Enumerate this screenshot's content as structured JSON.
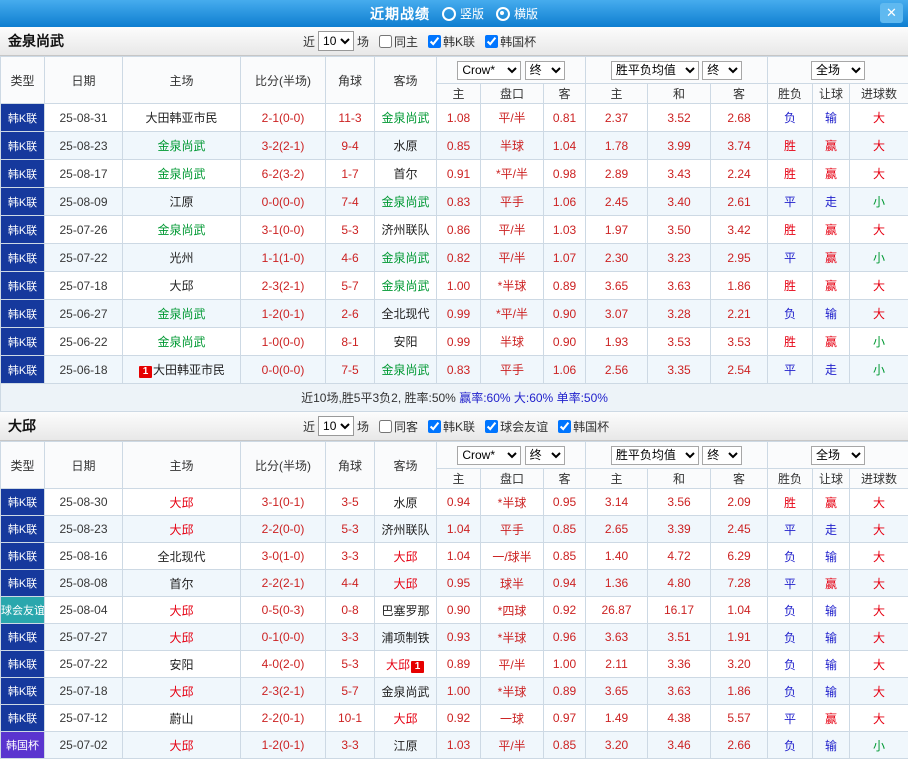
{
  "titlebar": {
    "title": "近期战绩",
    "radios": [
      {
        "label": "竖版",
        "selected": false
      },
      {
        "label": "横版",
        "selected": true
      }
    ],
    "close_label": "✕"
  },
  "table_header": {
    "type": "类型",
    "date": "日期",
    "home": "主场",
    "score": "比分(半场)",
    "corner": "角球",
    "away": "客场",
    "asian": {
      "company_select": "Crow*",
      "final_select": "终",
      "cols": [
        "主",
        "盘口",
        "客"
      ]
    },
    "europe": {
      "avg_select": "胜平负均值",
      "final_select": "终",
      "cols": [
        "主",
        "和",
        "客"
      ]
    },
    "full": {
      "scope_select": "全场",
      "cols": [
        "胜负",
        "让球",
        "进球数"
      ]
    }
  },
  "value_colors": {
    "red": "#e60012",
    "blue": "#2222cc",
    "green": "#009933"
  },
  "league_colors": {
    "韩K联": "#16399d",
    "球会友谊": "#2aa7ad",
    "韩国杯": "#5a35cf"
  },
  "sections": [
    {
      "team": "金泉尚武",
      "filter": {
        "near_label": "近",
        "count": "10",
        "games_label": "场",
        "checkboxes": [
          {
            "label": "同主",
            "checked": false
          },
          {
            "label": "韩K联",
            "checked": true
          },
          {
            "label": "韩国杯",
            "checked": true
          }
        ]
      },
      "rows": [
        {
          "lg": "韩K联",
          "d": "25-08-31",
          "h": "大田韩亚市民",
          "hc": "",
          "hb": "",
          "s": "2-1(0-0)",
          "cn": "11-3",
          "a": "金泉尚武",
          "ac": "green",
          "ab": "",
          "o1": "1.08",
          "pk": "平/半",
          "o2": "0.81",
          "e1": "2.37",
          "e2": "3.52",
          "e3": "2.68",
          "r1": "负",
          "r1c": "blue",
          "r2": "输",
          "r2c": "blue",
          "r3": "大",
          "r3c": "red"
        },
        {
          "lg": "韩K联",
          "d": "25-08-23",
          "h": "金泉尚武",
          "hc": "green",
          "hb": "",
          "s": "3-2(2-1)",
          "cn": "9-4",
          "a": "水原",
          "ac": "",
          "ab": "",
          "o1": "0.85",
          "pk": "半球",
          "o2": "1.04",
          "e1": "1.78",
          "e2": "3.99",
          "e3": "3.74",
          "r1": "胜",
          "r1c": "red",
          "r2": "赢",
          "r2c": "red",
          "r3": "大",
          "r3c": "red"
        },
        {
          "lg": "韩K联",
          "d": "25-08-17",
          "h": "金泉尚武",
          "hc": "green",
          "hb": "",
          "s": "6-2(3-2)",
          "cn": "1-7",
          "a": "首尔",
          "ac": "",
          "ab": "",
          "o1": "0.91",
          "pk": "*平/半",
          "o2": "0.98",
          "e1": "2.89",
          "e2": "3.43",
          "e3": "2.24",
          "r1": "胜",
          "r1c": "red",
          "r2": "赢",
          "r2c": "red",
          "r3": "大",
          "r3c": "red"
        },
        {
          "lg": "韩K联",
          "d": "25-08-09",
          "h": "江原",
          "hc": "",
          "hb": "",
          "s": "0-0(0-0)",
          "cn": "7-4",
          "a": "金泉尚武",
          "ac": "green",
          "ab": "",
          "o1": "0.83",
          "pk": "平手",
          "o2": "1.06",
          "e1": "2.45",
          "e2": "3.40",
          "e3": "2.61",
          "r1": "平",
          "r1c": "blue",
          "r2": "走",
          "r2c": "blue",
          "r3": "小",
          "r3c": "green"
        },
        {
          "lg": "韩K联",
          "d": "25-07-26",
          "h": "金泉尚武",
          "hc": "green",
          "hb": "",
          "s": "3-1(0-0)",
          "cn": "5-3",
          "a": "济州联队",
          "ac": "",
          "ab": "",
          "o1": "0.86",
          "pk": "平/半",
          "o2": "1.03",
          "e1": "1.97",
          "e2": "3.50",
          "e3": "3.42",
          "r1": "胜",
          "r1c": "red",
          "r2": "赢",
          "r2c": "red",
          "r3": "大",
          "r3c": "red"
        },
        {
          "lg": "韩K联",
          "d": "25-07-22",
          "h": "光州",
          "hc": "",
          "hb": "",
          "s": "1-1(1-0)",
          "cn": "4-6",
          "a": "金泉尚武",
          "ac": "green",
          "ab": "",
          "o1": "0.82",
          "pk": "平/半",
          "o2": "1.07",
          "e1": "2.30",
          "e2": "3.23",
          "e3": "2.95",
          "r1": "平",
          "r1c": "blue",
          "r2": "赢",
          "r2c": "red",
          "r3": "小",
          "r3c": "green"
        },
        {
          "lg": "韩K联",
          "d": "25-07-18",
          "h": "大邱",
          "hc": "",
          "hb": "",
          "s": "2-3(2-1)",
          "cn": "5-7",
          "a": "金泉尚武",
          "ac": "green",
          "ab": "",
          "o1": "1.00",
          "pk": "*半球",
          "o2": "0.89",
          "e1": "3.65",
          "e2": "3.63",
          "e3": "1.86",
          "r1": "胜",
          "r1c": "red",
          "r2": "赢",
          "r2c": "red",
          "r3": "大",
          "r3c": "red"
        },
        {
          "lg": "韩K联",
          "d": "25-06-27",
          "h": "金泉尚武",
          "hc": "green",
          "hb": "",
          "s": "1-2(0-1)",
          "cn": "2-6",
          "a": "全北现代",
          "ac": "",
          "ab": "",
          "o1": "0.99",
          "pk": "*平/半",
          "o2": "0.90",
          "e1": "3.07",
          "e2": "3.28",
          "e3": "2.21",
          "r1": "负",
          "r1c": "blue",
          "r2": "输",
          "r2c": "blue",
          "r3": "大",
          "r3c": "red"
        },
        {
          "lg": "韩K联",
          "d": "25-06-22",
          "h": "金泉尚武",
          "hc": "green",
          "hb": "",
          "s": "1-0(0-0)",
          "cn": "8-1",
          "a": "安阳",
          "ac": "",
          "ab": "",
          "o1": "0.99",
          "pk": "半球",
          "o2": "0.90",
          "e1": "1.93",
          "e2": "3.53",
          "e3": "3.53",
          "r1": "胜",
          "r1c": "red",
          "r2": "赢",
          "r2c": "red",
          "r3": "小",
          "r3c": "green"
        },
        {
          "lg": "韩K联",
          "d": "25-06-18",
          "h": "大田韩亚市民",
          "hc": "",
          "hb": "1",
          "s": "0-0(0-0)",
          "cn": "7-5",
          "a": "金泉尚武",
          "ac": "green",
          "ab": "",
          "o1": "0.83",
          "pk": "平手",
          "o2": "1.06",
          "e1": "2.56",
          "e2": "3.35",
          "e3": "2.54",
          "r1": "平",
          "r1c": "blue",
          "r2": "走",
          "r2c": "blue",
          "r3": "小",
          "r3c": "green"
        }
      ],
      "summary": [
        {
          "text": "近10场,胜5平3负2, 胜率:50% ",
          "color": "#333333"
        },
        {
          "text": "赢率:60% ",
          "color": "#2222cc"
        },
        {
          "text": "大:60% ",
          "color": "#2222cc"
        },
        {
          "text": "单率:50%",
          "color": "#2222cc"
        }
      ]
    },
    {
      "team": "大邱",
      "filter": {
        "near_label": "近",
        "count": "10",
        "games_label": "场",
        "checkboxes": [
          {
            "label": "同客",
            "checked": false
          },
          {
            "label": "韩K联",
            "checked": true
          },
          {
            "label": "球会友谊",
            "checked": true
          },
          {
            "label": "韩国杯",
            "checked": true
          }
        ]
      },
      "rows": [
        {
          "lg": "韩K联",
          "d": "25-08-30",
          "h": "大邱",
          "hc": "red",
          "hb": "",
          "s": "3-1(0-1)",
          "cn": "3-5",
          "a": "水原",
          "ac": "",
          "ab": "",
          "o1": "0.94",
          "pk": "*半球",
          "o2": "0.95",
          "e1": "3.14",
          "e2": "3.56",
          "e3": "2.09",
          "r1": "胜",
          "r1c": "red",
          "r2": "赢",
          "r2c": "red",
          "r3": "大",
          "r3c": "red"
        },
        {
          "lg": "韩K联",
          "d": "25-08-23",
          "h": "大邱",
          "hc": "red",
          "hb": "",
          "s": "2-2(0-0)",
          "cn": "5-3",
          "a": "济州联队",
          "ac": "",
          "ab": "",
          "o1": "1.04",
          "pk": "平手",
          "o2": "0.85",
          "e1": "2.65",
          "e2": "3.39",
          "e3": "2.45",
          "r1": "平",
          "r1c": "blue",
          "r2": "走",
          "r2c": "blue",
          "r3": "大",
          "r3c": "red"
        },
        {
          "lg": "韩K联",
          "d": "25-08-16",
          "h": "全北现代",
          "hc": "",
          "hb": "",
          "s": "3-0(1-0)",
          "cn": "3-3",
          "a": "大邱",
          "ac": "red",
          "ab": "",
          "o1": "1.04",
          "pk": "一/球半",
          "o2": "0.85",
          "e1": "1.40",
          "e2": "4.72",
          "e3": "6.29",
          "r1": "负",
          "r1c": "blue",
          "r2": "输",
          "r2c": "blue",
          "r3": "大",
          "r3c": "red"
        },
        {
          "lg": "韩K联",
          "d": "25-08-08",
          "h": "首尔",
          "hc": "",
          "hb": "",
          "s": "2-2(2-1)",
          "cn": "4-4",
          "a": "大邱",
          "ac": "red",
          "ab": "",
          "o1": "0.95",
          "pk": "球半",
          "o2": "0.94",
          "e1": "1.36",
          "e2": "4.80",
          "e3": "7.28",
          "r1": "平",
          "r1c": "blue",
          "r2": "赢",
          "r2c": "red",
          "r3": "大",
          "r3c": "red"
        },
        {
          "lg": "球会友谊",
          "d": "25-08-04",
          "h": "大邱",
          "hc": "red",
          "hb": "",
          "s": "0-5(0-3)",
          "cn": "0-8",
          "a": "巴塞罗那",
          "ac": "",
          "ab": "",
          "o1": "0.90",
          "pk": "*四球",
          "o2": "0.92",
          "e1": "26.87",
          "e2": "16.17",
          "e3": "1.04",
          "r1": "负",
          "r1c": "blue",
          "r2": "输",
          "r2c": "blue",
          "r3": "大",
          "r3c": "red"
        },
        {
          "lg": "韩K联",
          "d": "25-07-27",
          "h": "大邱",
          "hc": "red",
          "hb": "",
          "s": "0-1(0-0)",
          "cn": "3-3",
          "a": "浦项制铁",
          "ac": "",
          "ab": "",
          "o1": "0.93",
          "pk": "*半球",
          "o2": "0.96",
          "e1": "3.63",
          "e2": "3.51",
          "e3": "1.91",
          "r1": "负",
          "r1c": "blue",
          "r2": "输",
          "r2c": "blue",
          "r3": "大",
          "r3c": "red"
        },
        {
          "lg": "韩K联",
          "d": "25-07-22",
          "h": "安阳",
          "hc": "",
          "hb": "",
          "s": "4-0(2-0)",
          "cn": "5-3",
          "a": "大邱",
          "ac": "red",
          "ab": "1",
          "o1": "0.89",
          "pk": "平/半",
          "o2": "1.00",
          "e1": "2.11",
          "e2": "3.36",
          "e3": "3.20",
          "r1": "负",
          "r1c": "blue",
          "r2": "输",
          "r2c": "blue",
          "r3": "大",
          "r3c": "red"
        },
        {
          "lg": "韩K联",
          "d": "25-07-18",
          "h": "大邱",
          "hc": "red",
          "hb": "",
          "s": "2-3(2-1)",
          "cn": "5-7",
          "a": "金泉尚武",
          "ac": "",
          "ab": "",
          "o1": "1.00",
          "pk": "*半球",
          "o2": "0.89",
          "e1": "3.65",
          "e2": "3.63",
          "e3": "1.86",
          "r1": "负",
          "r1c": "blue",
          "r2": "输",
          "r2c": "blue",
          "r3": "大",
          "r3c": "red"
        },
        {
          "lg": "韩K联",
          "d": "25-07-12",
          "h": "蔚山",
          "hc": "",
          "hb": "",
          "s": "2-2(0-1)",
          "cn": "10-1",
          "a": "大邱",
          "ac": "red",
          "ab": "",
          "o1": "0.92",
          "pk": "一球",
          "o2": "0.97",
          "e1": "1.49",
          "e2": "4.38",
          "e3": "5.57",
          "r1": "平",
          "r1c": "blue",
          "r2": "赢",
          "r2c": "red",
          "r3": "大",
          "r3c": "red"
        },
        {
          "lg": "韩国杯",
          "d": "25-07-02",
          "h": "大邱",
          "hc": "red",
          "hb": "",
          "s": "1-2(0-1)",
          "cn": "3-3",
          "a": "江原",
          "ac": "",
          "ab": "",
          "o1": "1.03",
          "pk": "平/半",
          "o2": "0.85",
          "e1": "3.20",
          "e2": "3.46",
          "e3": "2.66",
          "r1": "负",
          "r1c": "blue",
          "r2": "输",
          "r2c": "blue",
          "r3": "小",
          "r3c": "green"
        }
      ],
      "summary": []
    }
  ]
}
